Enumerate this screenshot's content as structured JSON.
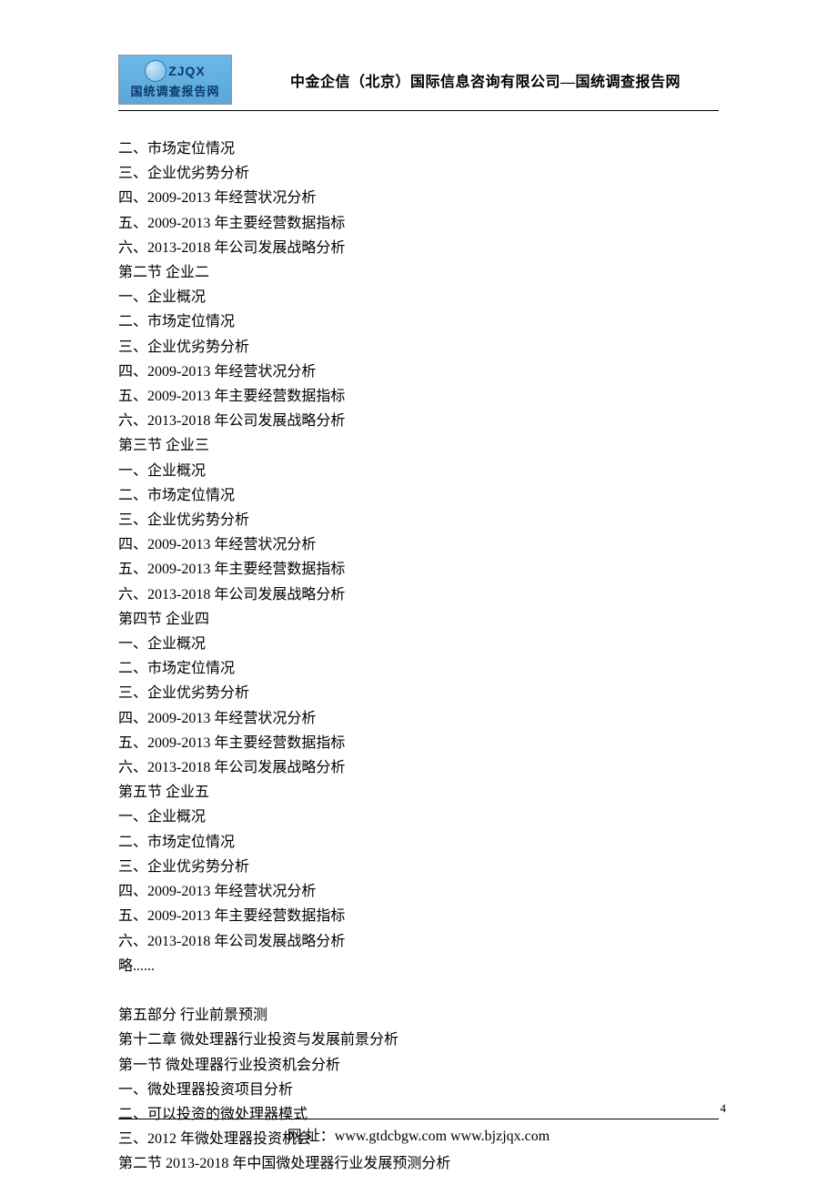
{
  "logo": {
    "brand_code": "ZJQX",
    "brand_text": "国统调查报告网"
  },
  "header": {
    "title": "中金企信（北京）国际信息咨询有限公司—国统调查报告网"
  },
  "content": {
    "lines": [
      "二、市场定位情况",
      "三、企业优劣势分析",
      "四、2009-2013 年经营状况分析",
      "五、2009-2013 年主要经营数据指标",
      "六、2013-2018 年公司发展战略分析",
      "第二节  企业二",
      "一、企业概况",
      "二、市场定位情况",
      "三、企业优劣势分析",
      "四、2009-2013 年经营状况分析",
      "五、2009-2013 年主要经营数据指标",
      "六、2013-2018 年公司发展战略分析",
      "第三节  企业三",
      "一、企业概况",
      "二、市场定位情况",
      "三、企业优劣势分析",
      "四、2009-2013 年经营状况分析",
      "五、2009-2013 年主要经营数据指标",
      "六、2013-2018 年公司发展战略分析",
      "第四节  企业四",
      "一、企业概况",
      "二、市场定位情况",
      "三、企业优劣势分析",
      "四、2009-2013 年经营状况分析",
      "五、2009-2013 年主要经营数据指标",
      "六、2013-2018 年公司发展战略分析",
      "第五节  企业五",
      "一、企业概况",
      "二、市场定位情况",
      "三、企业优劣势分析",
      "四、2009-2013 年经营状况分析",
      "五、2009-2013 年主要经营数据指标",
      "六、2013-2018 年公司发展战略分析",
      "略......",
      "",
      "第五部分  行业前景预测",
      "第十二章  微处理器行业投资与发展前景分析",
      "第一节  微处理器行业投资机会分析",
      "一、微处理器投资项目分析",
      "二、可以投资的微处理器模式",
      "三、2012 年微处理器投资机会",
      "第二节  2013-2018 年中国微处理器行业发展预测分析"
    ]
  },
  "footer": {
    "page_number": "4",
    "text": "网  址：www.gtdcbgw.com      www.bjzjqx.com"
  }
}
